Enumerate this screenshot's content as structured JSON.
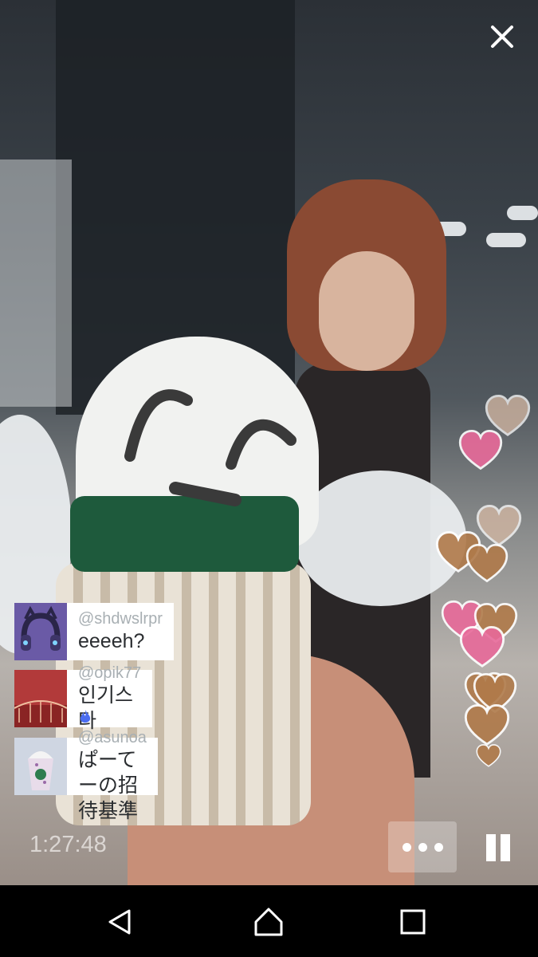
{
  "colors": {
    "heart_pink": "#e86a9a",
    "heart_brown": "#b07a4a",
    "heart_tan": "#d6b9a4",
    "flame_blue": "#4a6cf0",
    "comment_user": "#a8afb3",
    "comment_text": "#2a2d30"
  },
  "header": {
    "close_icon": "close-icon"
  },
  "comments": [
    {
      "user": "@shdwslrpr",
      "text": "eeeeh?",
      "avatar": "purple-headphones-avatar",
      "verified_icon": null
    },
    {
      "user": "@opik77",
      "text": "인기스타",
      "avatar": "red-bridge-avatar",
      "verified_icon": null
    },
    {
      "user": "@asunoa",
      "text": "ぱーてーの招待基準",
      "avatar": "frappuccino-avatar",
      "verified_icon": "flame-icon"
    }
  ],
  "playback": {
    "elapsed": "1:27:48",
    "more_icon": "more-icon",
    "pause_icon": "pause-icon"
  },
  "hearts": [
    {
      "color": "tan"
    },
    {
      "color": "pink"
    },
    {
      "color": "tan"
    },
    {
      "color": "brown"
    },
    {
      "color": "brown"
    },
    {
      "color": "pink"
    },
    {
      "color": "brown"
    },
    {
      "color": "pink"
    },
    {
      "color": "brown"
    },
    {
      "color": "brown"
    },
    {
      "color": "brown"
    },
    {
      "color": "brown"
    }
  ],
  "navbar": {
    "back_icon": "back-icon",
    "home_icon": "home-icon",
    "recents_icon": "recents-icon"
  }
}
